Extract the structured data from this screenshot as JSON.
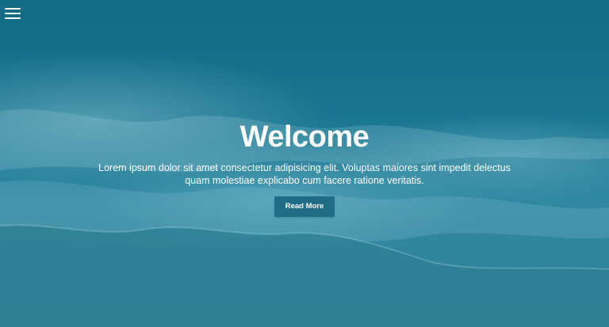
{
  "nav": {
    "menu_icon": "hamburger-menu-icon"
  },
  "hero": {
    "title": "Welcome",
    "description_line1": "Lorem ipsum dolor sit amet consectetur adipisicing elit. Voluptas maiores sint impedit delectus",
    "description_line2": "quam molestiae explicabo cum facere ratione veritatis.",
    "button_label": "Read More"
  },
  "colors": {
    "background": "#1c6f86",
    "button": "#1f6d86",
    "text": "#ffffff"
  }
}
